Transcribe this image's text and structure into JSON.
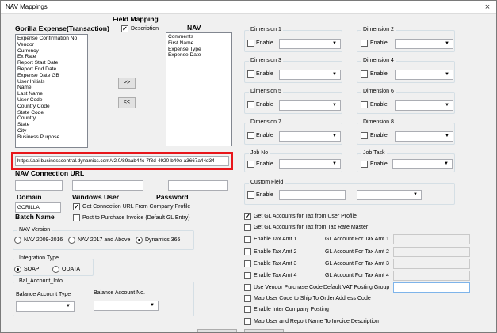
{
  "window": {
    "title": "NAV Mappings",
    "close_glyph": "×"
  },
  "field_mapping": {
    "heading": "Field Mapping",
    "description_label": "Description",
    "gorilla_heading": "Gorilla Expense(Transaction)",
    "nav_heading": "NAV",
    "gorilla_fields": [
      "Expense Confirmation No",
      "Vendor",
      "Currency",
      "Ex Rate",
      "Report Start Date",
      "Report End Date",
      "Expense Date GB",
      "User Initials",
      "Name",
      "Last Name",
      "User Code",
      "Country Code",
      "State Code",
      "Country",
      "State",
      "City",
      "Business Purpose"
    ],
    "nav_fields": [
      "Comments",
      "First Name",
      "Expense Type",
      "Expense Date"
    ],
    "add_button": ">>",
    "remove_button": "<<"
  },
  "connection": {
    "url_value": "https://api.businesscentral.dynamics.com/v2.0/89aab44c-7f3d-4920-b40e-a3667a44d34",
    "url_heading": "NAV Connection URL",
    "domain_label": "Domain",
    "windows_user_label": "Windows User",
    "password_label": "Password",
    "domain_value": "GORILLA",
    "get_url_label": "Get Connection URL From Company Profile",
    "batch_name_label": "Batch Name",
    "post_invoice_label": "Post to Purchase Invoice (Default GL Entry)"
  },
  "nav_version": {
    "legend": "NAV Version",
    "options": [
      "NAV 2009-2016",
      "NAV 2017 and Above",
      "Dynamics 365"
    ],
    "selected": "Dynamics 365"
  },
  "integration_type": {
    "legend": "Integration Type",
    "options": [
      "SOAP",
      "ODATA"
    ],
    "selected": "SOAP"
  },
  "bal_account": {
    "legend": "Bal_Account_Info",
    "type_label": "Balance Account Type",
    "no_label": "Balance Account No."
  },
  "dimensions": {
    "items": [
      {
        "label": "Dimension 1",
        "enable": "Enable"
      },
      {
        "label": "Dimension 2",
        "enable": "Enable"
      },
      {
        "label": "Dimension 3",
        "enable": "Enable"
      },
      {
        "label": "Dimension 4",
        "enable": "Enable"
      },
      {
        "label": "Dimension 5",
        "enable": "Enable"
      },
      {
        "label": "Dimension 6",
        "enable": "Enable"
      },
      {
        "label": "Dimension 7",
        "enable": "Enable"
      },
      {
        "label": "Dimension 8",
        "enable": "Enable"
      }
    ],
    "job_no": "Job No",
    "job_task": "Job Task",
    "custom_field": "Custom Field",
    "enable": "Enable"
  },
  "gl_options": {
    "from_user_profile": "Get GL Accounts for Tax from User Profile",
    "from_tax_rate_master": "Get GL Accounts for Tax from Tax Rate Master",
    "tax_rows": [
      {
        "enable": "Enable Tax Amt 1",
        "gl": "GL Account For Tax Amt 1"
      },
      {
        "enable": "Enable Tax Amt 2",
        "gl": "GL Account For Tax Amt 2"
      },
      {
        "enable": "Enable Tax Amt 3",
        "gl": "GL Account For Tax Amt 3"
      },
      {
        "enable": "Enable Tax Amt 4",
        "gl": "GL Account For Tax Amt 4"
      }
    ],
    "vendor_purchase_code": "Use Vendor Purchase Code",
    "default_vat": "Default VAT Posting Group",
    "map_user_code": "Map User Code to Ship To Order Address Code",
    "enable_intercompany": "Enable Inter Company Posting",
    "map_user_report": "Map User and Report Name To Invoice Description"
  },
  "colors": {
    "highlight": "#e8161b",
    "window_bg": "#f0f0f0"
  }
}
